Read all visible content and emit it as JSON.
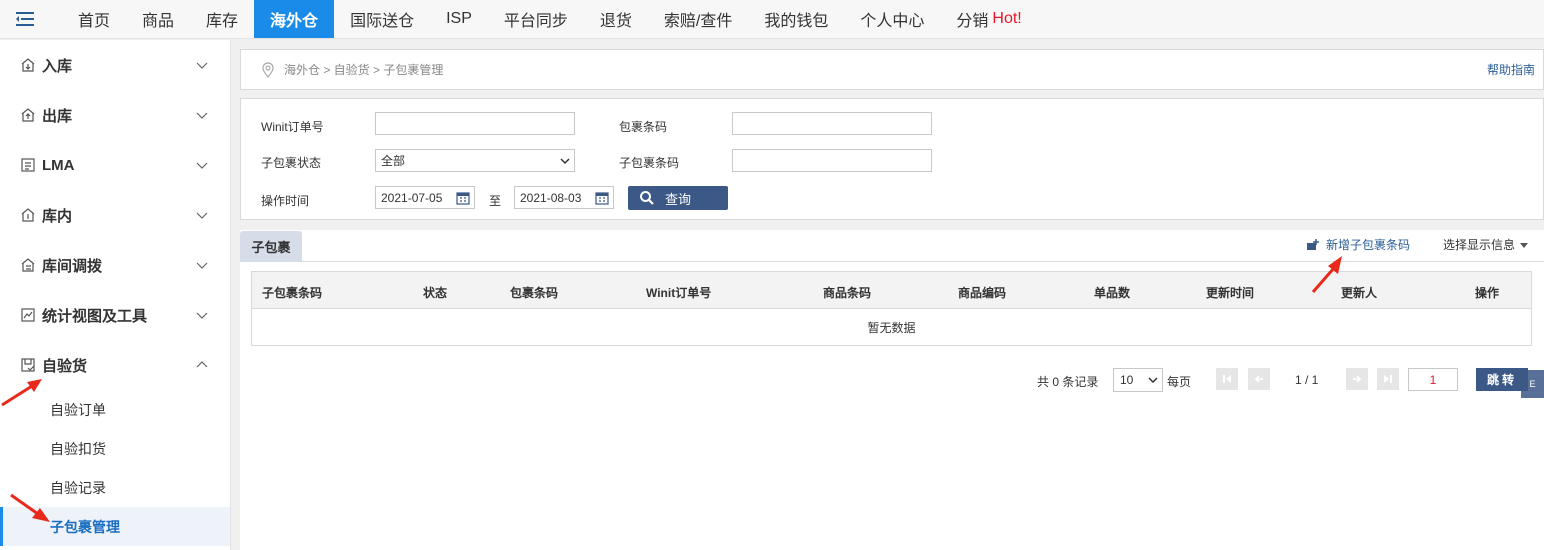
{
  "nav": {
    "items": [
      "首页",
      "商品",
      "库存",
      "海外仓",
      "国际送仓",
      "ISP",
      "平台同步",
      "退货",
      "索赔/查件",
      "我的钱包",
      "个人中心",
      "分销"
    ],
    "hot": "Hot!"
  },
  "sidebar": {
    "groups": [
      {
        "label": "入库",
        "icon": "inbound-icon"
      },
      {
        "label": "出库",
        "icon": "outbound-icon"
      },
      {
        "label": "LMA",
        "icon": "list-icon"
      },
      {
        "label": "库内",
        "icon": "warehouse-icon"
      },
      {
        "label": "库间调拨",
        "icon": "transfer-icon"
      },
      {
        "label": "统计视图及工具",
        "icon": "chart-icon"
      },
      {
        "label": "自验货",
        "icon": "inspection-icon"
      }
    ],
    "sub_items": [
      "自验订单",
      "自验扣货",
      "自验记录",
      "子包裹管理"
    ]
  },
  "breadcrumb": {
    "path": "海外仓 > 自验货 > 子包裹管理",
    "help": "帮助指南"
  },
  "filters": {
    "order_label": "Winit订单号",
    "parcel_barcode_label": "包裹条码",
    "sub_status_label": "子包裹状态",
    "sub_status_value": "全部",
    "sub_barcode_label": "子包裹条码",
    "time_label": "操作时间",
    "date_from": "2021-07-05",
    "to_label": "至",
    "date_to": "2021-08-03",
    "query_label": "查询"
  },
  "content": {
    "tab": "子包裹",
    "add_link": "新增子包裹条码",
    "display_option": "选择显示信息",
    "columns": [
      "子包裹条码",
      "状态",
      "包裹条码",
      "Winit订单号",
      "商品条码",
      "商品编码",
      "单品数",
      "更新时间",
      "更新人",
      "操作"
    ],
    "empty": "暂无数据"
  },
  "pager": {
    "total": "共 0 条记录",
    "page_size": "10",
    "per_page": "每页",
    "page_info": "1 / 1",
    "page_input": "1",
    "jump": "跳转"
  },
  "edge_tab": "E"
}
